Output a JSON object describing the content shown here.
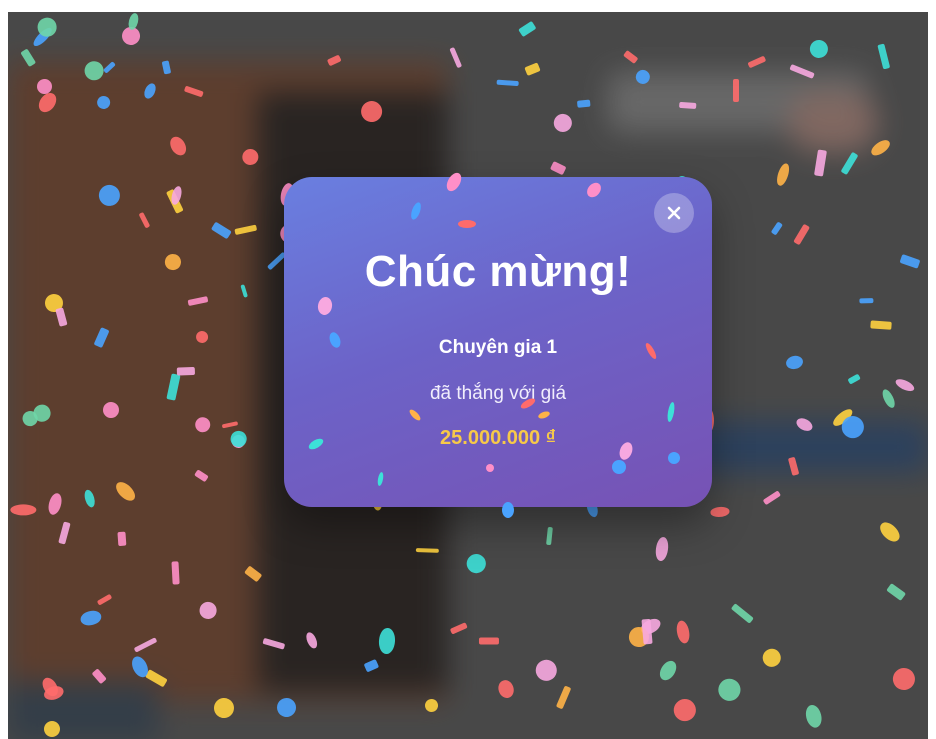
{
  "modal": {
    "title": "Chúc mừng!",
    "winner": "Chuyên gia 1",
    "message": "đã thắng với giá",
    "price": "25.000.000 ₫",
    "close_label": "×"
  },
  "colors": {
    "modal_gradient_start": "#6a7fe0",
    "modal_gradient_end": "#7752b4",
    "price": "#f7c948",
    "backdrop": "#5a5a5a"
  },
  "icons": {
    "close": "close-icon"
  }
}
